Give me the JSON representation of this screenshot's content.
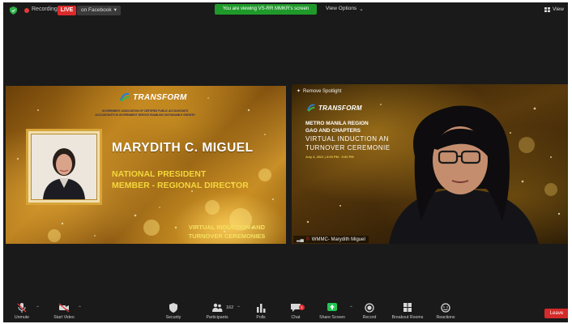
{
  "topbar": {
    "recording_label": "Recording",
    "live_label": "LIVE",
    "facebook_label": "on Facebook",
    "share_banner": "You are viewing VS-RR MMKR's screen",
    "view_options_label": "View Options",
    "view_label": "View"
  },
  "slide": {
    "logo_text": "TRANSFORM",
    "tagline_lines": [
      "GOVERNMENT ASSOCIATION OF CERTIFIED PUBLIC ACCOUNTANTS",
      "ACCOUNTANTS IN GOVERNMENT SERVICE ENABLING SUSTAINABLE GROWTH"
    ],
    "name": "MARYDITH C. MIGUEL",
    "title_line1": "NATIONAL PRESIDENT",
    "title_line2": "MEMBER - REGIONAL DIRECTOR",
    "event_line1": "VIRTUAL INDUCTION AND",
    "event_line2": "TURNOVER CEREMONIES"
  },
  "video": {
    "spotlight_label": "Remove Spotlight",
    "logo_text": "TRANSFORM",
    "line1": "METRO MANILA REGION",
    "line2": "GAO AND CHAPTERS",
    "line3": "VIRTUAL INDUCTION AN",
    "line4": "TURNOVER CEREMONIE",
    "date_line": "July 3, 2021 | 3:00 PM - 5:00 PM",
    "participant_name": "WMMC- Marydith Miguel"
  },
  "toolbar": {
    "items": [
      {
        "label": "Unmute",
        "icon": "mic-muted-icon"
      },
      {
        "label": "Start Video",
        "icon": "video-off-icon"
      },
      {
        "label": "Security",
        "icon": "shield-icon"
      },
      {
        "label": "Participants",
        "icon": "participants-icon"
      },
      {
        "label": "Polls",
        "icon": "polls-icon"
      },
      {
        "label": "Chat",
        "icon": "chat-icon"
      },
      {
        "label": "Share Screen",
        "icon": "share-screen-icon"
      },
      {
        "label": "Record",
        "icon": "record-icon"
      },
      {
        "label": "Breakout Rooms",
        "icon": "breakout-rooms-icon"
      },
      {
        "label": "Reactions",
        "icon": "reactions-icon"
      }
    ],
    "participants_count": "162",
    "chat_badge": "1",
    "leave_label": "Leave"
  },
  "colors": {
    "live_red": "#d92b2b",
    "share_green": "#1f9a2a",
    "leave_red": "#d42a2a",
    "gold_title": "#f4d73c"
  }
}
